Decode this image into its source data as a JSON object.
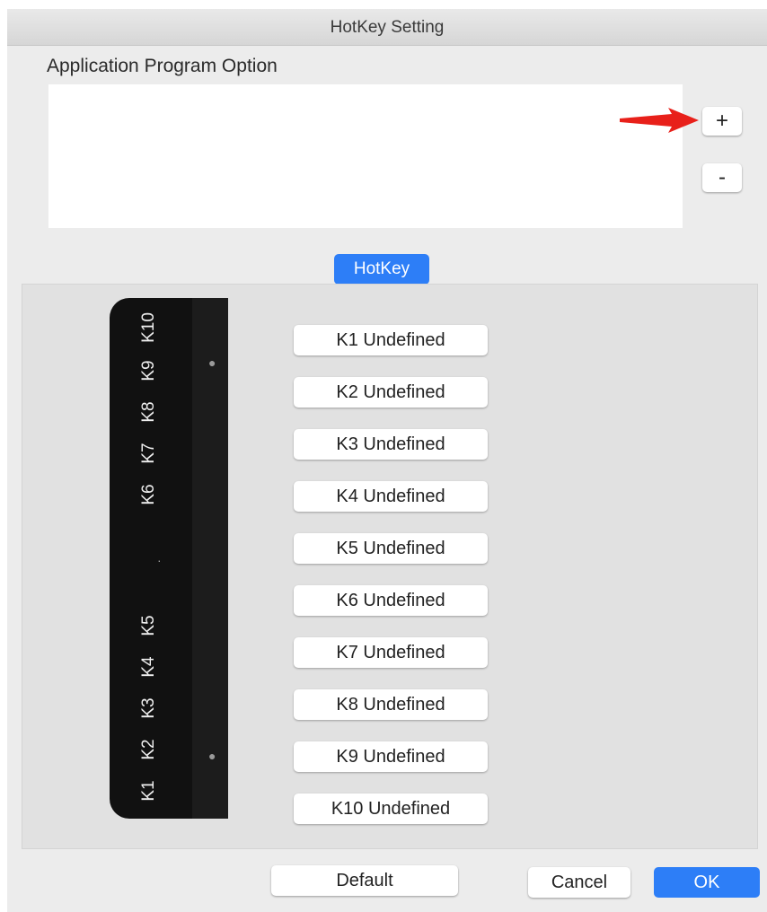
{
  "window": {
    "title": "HotKey Setting"
  },
  "app_section": {
    "label": "Application Program Option",
    "add_label": "+",
    "remove_label": "-"
  },
  "tab": {
    "label": "HotKey"
  },
  "tablet": {
    "key_labels": [
      "K10",
      "K9",
      "K8",
      "K7",
      "K6",
      "K5",
      "K4",
      "K3",
      "K2",
      "K1"
    ]
  },
  "hotkeys": [
    "K1 Undefined",
    "K2 Undefined",
    "K3 Undefined",
    "K4 Undefined",
    "K5 Undefined",
    "K6 Undefined",
    "K7 Undefined",
    "K8 Undefined",
    "K9 Undefined",
    "K10 Undefined"
  ],
  "footer": {
    "default_label": "Default",
    "cancel_label": "Cancel",
    "ok_label": "OK"
  },
  "colors": {
    "accent": "#2d7ef7",
    "annotation_arrow": "#e8201a",
    "tablet": "#111111"
  }
}
